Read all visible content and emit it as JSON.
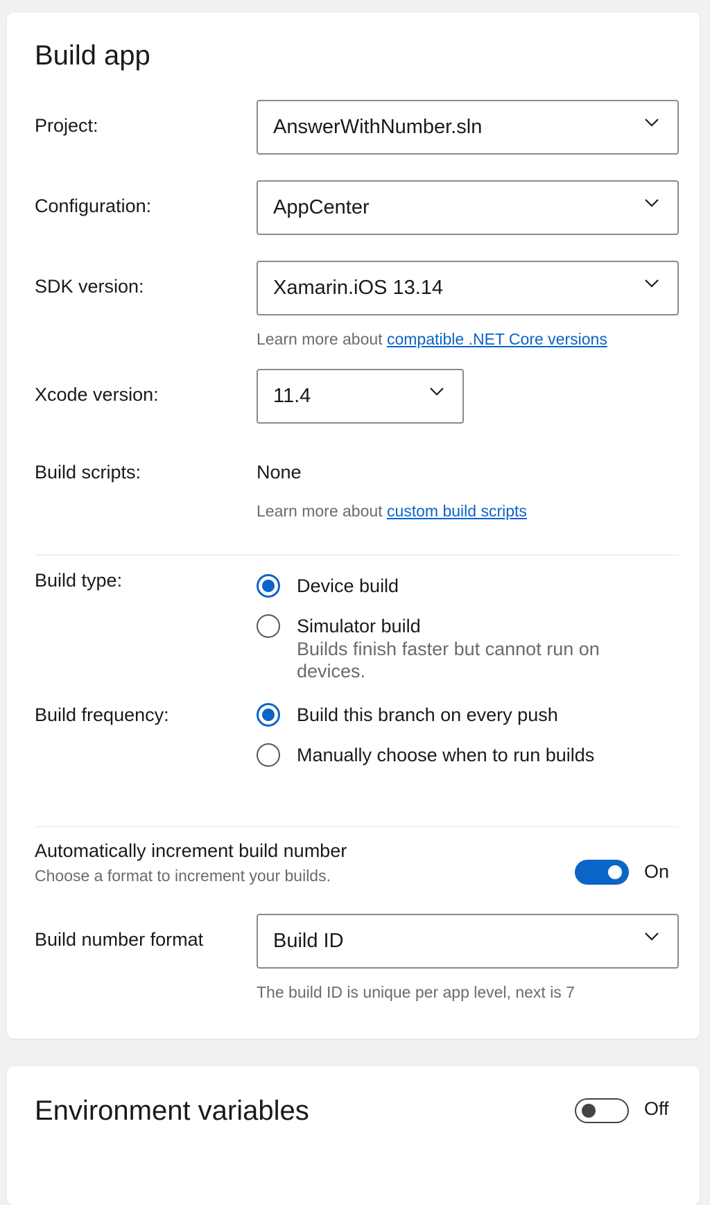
{
  "build_app": {
    "title": "Build app",
    "project": {
      "label": "Project:",
      "value": "AnswerWithNumber.sln"
    },
    "configuration": {
      "label": "Configuration:",
      "value": "AppCenter"
    },
    "sdk": {
      "label": "SDK version:",
      "value": "Xamarin.iOS 13.14",
      "hint_prefix": "Learn more about ",
      "hint_link": "compatible .NET Core versions"
    },
    "xcode": {
      "label": "Xcode version:",
      "value": "11.4"
    },
    "build_scripts": {
      "label": "Build scripts:",
      "value": "None",
      "hint_prefix": "Learn more about ",
      "hint_link": "custom build scripts"
    },
    "build_type": {
      "label": "Build type:",
      "options": [
        {
          "label": "Device build",
          "checked": true
        },
        {
          "label": "Simulator build",
          "checked": false,
          "description": "Builds finish faster but cannot run on devices."
        }
      ]
    },
    "build_frequency": {
      "label": "Build frequency:",
      "options": [
        {
          "label": "Build this branch on every push",
          "checked": true
        },
        {
          "label": "Manually choose when to run builds",
          "checked": false
        }
      ]
    },
    "auto_increment": {
      "label": "Automatically increment build number",
      "description": "Choose a format to increment your builds.",
      "state_label": "On",
      "enabled": true
    },
    "build_number_format": {
      "label": "Build number format",
      "value": "Build ID",
      "hint": "The build ID is unique per app level, next is 7"
    }
  },
  "environment_variables": {
    "title": "Environment variables",
    "state_label": "Off",
    "enabled": false
  },
  "colors": {
    "accent": "#0b64c8",
    "background": "#f1f1f1",
    "card": "#ffffff",
    "hint_text": "#6b6b6b"
  },
  "icons": {
    "dropdown": "chevron-down-icon",
    "radio_checked": "radio-checked",
    "radio_unchecked": "radio-unchecked"
  }
}
